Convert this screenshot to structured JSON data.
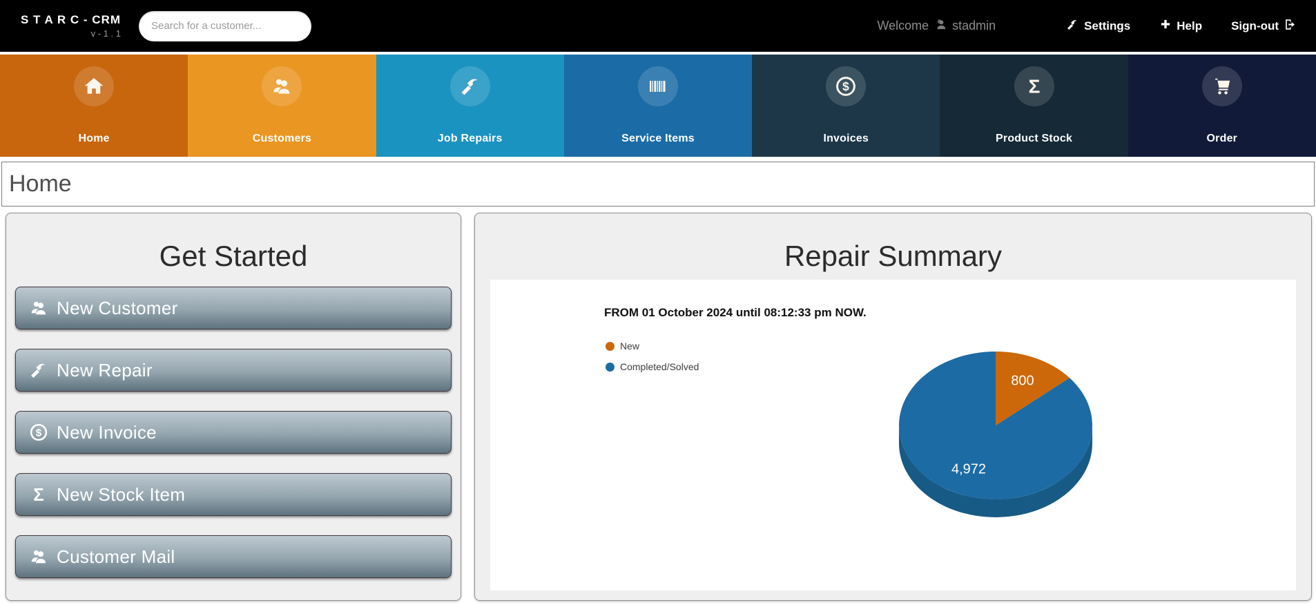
{
  "topbar": {
    "brand": "S T A R C - CRM",
    "version": "v - 1 . 1",
    "search_placeholder": "Search for a customer...",
    "welcome_text": "Welcome",
    "username": "stadmin",
    "settings_label": "Settings",
    "help_label": "Help",
    "signout_label": "Sign-out"
  },
  "nav": {
    "items": [
      {
        "label": "Home",
        "icon": "home-icon",
        "color": "#c8660e"
      },
      {
        "label": "Customers",
        "icon": "people-icon",
        "color": "#ea9622"
      },
      {
        "label": "Job Repairs",
        "icon": "hammer-icon",
        "color": "#1b93c1"
      },
      {
        "label": "Service Items",
        "icon": "barcode-icon",
        "color": "#1b6ca6"
      },
      {
        "label": "Invoices",
        "icon": "dollar-circle-icon",
        "color": "#1d3749"
      },
      {
        "label": "Product Stock",
        "icon": "sigma-icon",
        "color": "#152936"
      },
      {
        "label": "Order",
        "icon": "cart-icon",
        "color": "#111a38"
      }
    ]
  },
  "page": {
    "title": "Home"
  },
  "get_started": {
    "title": "Get Started",
    "buttons": [
      {
        "label": "New Customer",
        "icon": "people-icon"
      },
      {
        "label": "New Repair",
        "icon": "hammer-icon"
      },
      {
        "label": "New Invoice",
        "icon": "dollar-circle-icon"
      },
      {
        "label": "New Stock Item",
        "icon": "sigma-icon"
      },
      {
        "label": "Customer Mail",
        "icon": "people-icon"
      }
    ]
  },
  "repair_summary": {
    "title": "Repair Summary",
    "period_text": "FROM 01 October 2024 until 08:12:33 pm NOW."
  },
  "chart_data": {
    "type": "pie",
    "title": "Repair Summary",
    "subtitle": "FROM 01 October 2024 until 08:12:33 pm NOW.",
    "effect": "3d",
    "legend_position": "top-left",
    "depth_color": "#175a85",
    "series": [
      {
        "name": "New",
        "value": 800,
        "label": "800",
        "color": "#cc680a"
      },
      {
        "name": "Completed/Solved",
        "value": 4972,
        "label": "4,972",
        "color": "#1d6ba4"
      }
    ]
  }
}
